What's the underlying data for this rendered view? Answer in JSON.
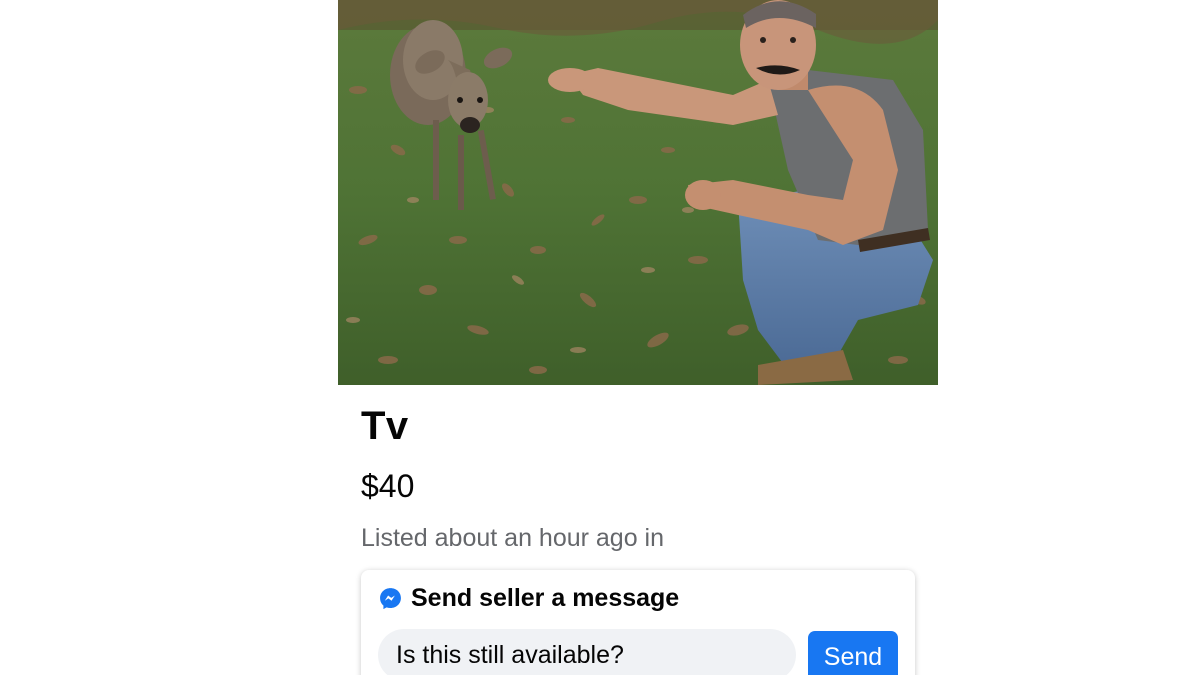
{
  "listing": {
    "photo_description": "Man crouching in a grassy field with fallen leaves, gesturing toward a young deer",
    "title": "Tv",
    "price": "$40",
    "listed_text": "Listed about an hour ago in"
  },
  "message_card": {
    "header_icon": "messenger-icon",
    "header_label": "Send seller a message",
    "input_value": "Is this still available?",
    "send_label": "Send"
  },
  "colors": {
    "accent": "#1877f2",
    "text_primary": "#050505",
    "text_secondary": "#65676b",
    "input_bg": "#f0f2f5"
  }
}
